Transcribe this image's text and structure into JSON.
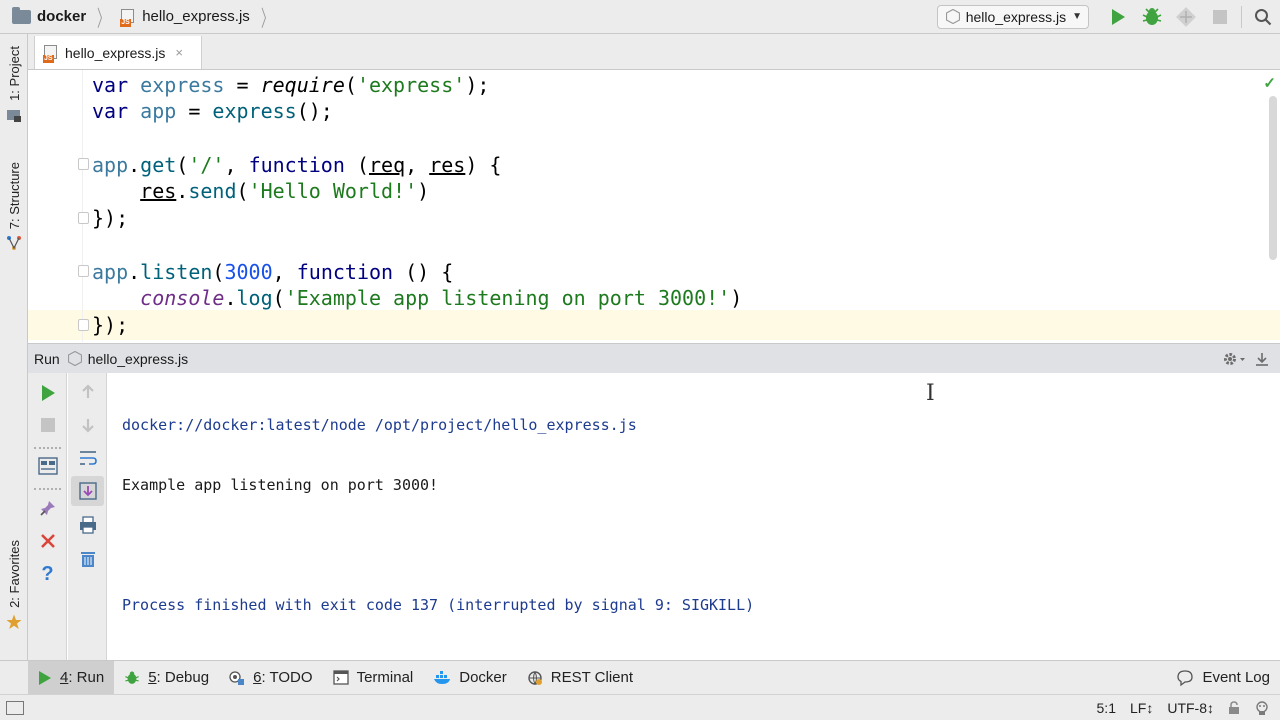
{
  "navbar": {
    "project": "docker",
    "file": "hello_express.js",
    "run_config": "hello_express.js"
  },
  "editor_tab": {
    "label": "hello_express.js",
    "close": "×"
  },
  "left_tools": {
    "project": "1: Project",
    "structure": "7: Structure",
    "favorites": "2: Favorites"
  },
  "code": {
    "l1": [
      "var",
      " ",
      "express",
      " = ",
      "require",
      "(",
      "'express'",
      ");"
    ],
    "l2": [
      "var",
      " ",
      "app",
      " = ",
      "express",
      "();"
    ],
    "l4": [
      "app",
      ".",
      "get",
      "(",
      "'/'",
      ", ",
      "function",
      " (",
      "req",
      ", ",
      "res",
      ") {"
    ],
    "l5": [
      "    ",
      "res",
      ".",
      "send",
      "(",
      "'Hello World!'",
      ")"
    ],
    "l6": "});",
    "l8": [
      "app",
      ".",
      "listen",
      "(",
      "3000",
      ", ",
      "function",
      " () {"
    ],
    "l9": [
      "    ",
      "console",
      ".",
      "log",
      "(",
      "'Example app listening on port 3000!'",
      ")"
    ],
    "l10": "});"
  },
  "run_header": {
    "title": "Run",
    "config": "hello_express.js"
  },
  "console": {
    "line1": "docker://docker:latest/node /opt/project/hello_express.js",
    "line2": "Example app listening on port 3000!",
    "line3": "",
    "line4": "Process finished with exit code 137 (interrupted by signal 9: SIGKILL)"
  },
  "bottom_tabs": {
    "run_num": "4",
    "run_rest": ": Run",
    "debug_num": "5",
    "debug_rest": ": Debug",
    "todo_num": "6",
    "todo_rest": ": TODO",
    "terminal": "Terminal",
    "docker": "Docker",
    "rest_client": "REST Client",
    "event_log": "Event Log"
  },
  "status": {
    "position": "5:1",
    "line_sep": "LF↕",
    "encoding": "UTF-8↕"
  },
  "colors": {
    "run_green": "#3fa33f",
    "keyword": "#000080",
    "string": "#1e7a1e",
    "number": "#1750eb"
  }
}
